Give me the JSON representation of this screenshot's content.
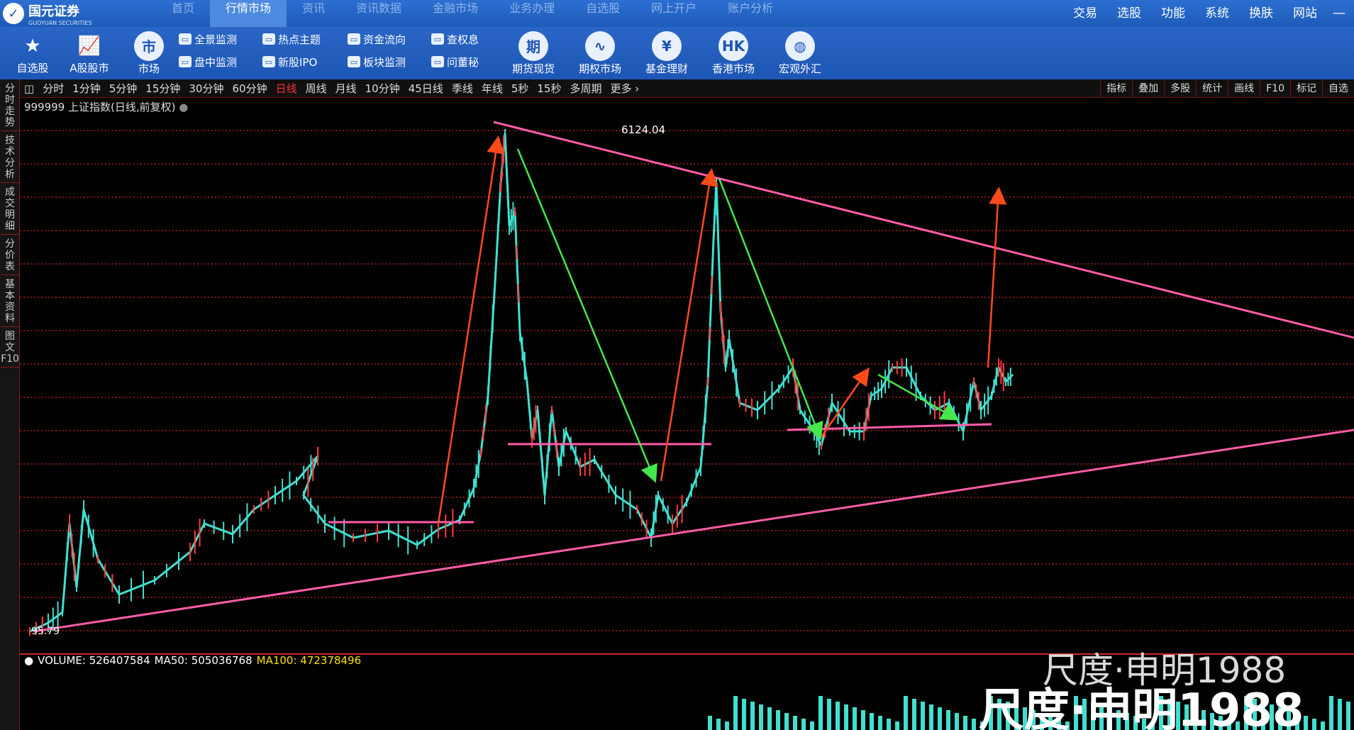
{
  "window": {
    "logo_text": "国元证券",
    "logo_sub": "GUOYUAN SECURITIES",
    "top_menu": [
      "首页",
      "行情市场",
      "资讯",
      "资讯数据",
      "金融市场",
      "业务办理",
      "自选股",
      "网上开户",
      "账户分析"
    ],
    "right_menu": [
      "交易",
      "选股",
      "功能",
      "系统",
      "换肤",
      "网站"
    ]
  },
  "toolbar": {
    "big": [
      {
        "label": "自选股",
        "icon": "star-icon",
        "glyph": "★"
      },
      {
        "label": "A股股市",
        "icon": "chart-up-icon",
        "glyph": "📈"
      },
      {
        "label": "市场",
        "icon": "market-icon",
        "glyph": "市"
      }
    ],
    "small_col1": [
      {
        "label": "全景监测",
        "icon": "monitor-icon"
      },
      {
        "label": "盘中监测",
        "icon": "monitor-icon"
      }
    ],
    "small_col2": [
      {
        "label": "热点主题",
        "icon": "hotspot-icon"
      },
      {
        "label": "新股IPO",
        "icon": "ipo-icon"
      }
    ],
    "small_col3": [
      {
        "label": "资金流向",
        "icon": "flow-icon"
      },
      {
        "label": "板块监测",
        "icon": "sector-icon"
      }
    ],
    "small_col4": [
      {
        "label": "查权息",
        "icon": "dividend-icon"
      },
      {
        "label": "问董秘",
        "icon": "person-icon"
      }
    ],
    "big2": [
      {
        "label": "期货现货",
        "icon": "futures-icon",
        "glyph": "期"
      },
      {
        "label": "期权市场",
        "icon": "options-icon",
        "glyph": "∿"
      },
      {
        "label": "基金理财",
        "icon": "fund-icon",
        "glyph": "¥"
      },
      {
        "label": "香港市场",
        "icon": "hk-icon",
        "glyph": "HK"
      },
      {
        "label": "宏观外汇",
        "icon": "globe-icon",
        "glyph": "◍"
      }
    ]
  },
  "left_tabs": [
    "分时走势",
    "技术分析",
    "成交明细",
    "分价表",
    "基本资料",
    "图文F10"
  ],
  "periods": [
    "分时",
    "1分钟",
    "5分钟",
    "15分钟",
    "30分钟",
    "60分钟",
    "日线",
    "周线",
    "月线",
    "10分钟",
    "45日线",
    "季线",
    "年线",
    "5秒",
    "15秒",
    "多周期",
    "更多 ›"
  ],
  "active_period": "日线",
  "tools": [
    "指标",
    "叠加",
    "多股",
    "统计",
    "画线",
    "F10",
    "标记",
    "自选"
  ],
  "index_label": "999999 上证指数(日线,前复权)",
  "peak_label": "6124.04",
  "low_label": "95.79",
  "volume": {
    "label": "VOLUME: 526407584",
    "ma50": "MA50: 505036768",
    "ma100": "MA100: 472378496"
  },
  "watermarks": [
    "尺度·申明1988",
    "尺度·申明1988"
  ],
  "colors": {
    "candle_up": "#ff3b3b",
    "candle_down": "#40e0d0",
    "trend_line": "#ff5ca8",
    "grid": "#c8281e"
  }
}
